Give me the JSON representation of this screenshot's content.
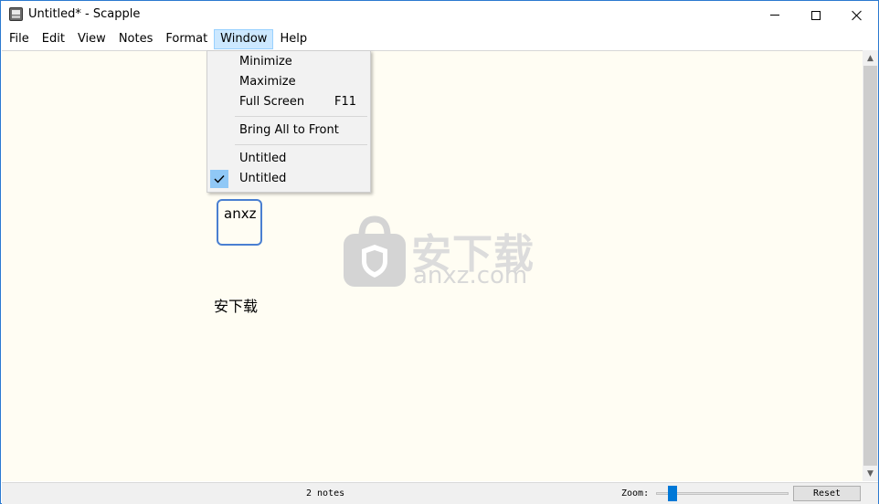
{
  "window": {
    "title": "Untitled* - Scapple",
    "app_icon": "scapple-app-icon"
  },
  "menubar": {
    "items": [
      "File",
      "Edit",
      "View",
      "Notes",
      "Format",
      "Window",
      "Help"
    ],
    "active": "Window"
  },
  "window_menu": {
    "items": [
      {
        "label": "Minimize",
        "shortcut": ""
      },
      {
        "label": "Maximize",
        "shortcut": ""
      },
      {
        "label": "Full Screen",
        "shortcut": "F11"
      },
      {
        "label": "Bring All to Front",
        "shortcut": ""
      },
      {
        "label": "Untitled",
        "shortcut": ""
      },
      {
        "label": "Untitled",
        "shortcut": "",
        "checked": true
      }
    ]
  },
  "canvas": {
    "notes": [
      {
        "text": "anxz",
        "style": "bordered"
      },
      {
        "text": "安下载",
        "style": "plain"
      }
    ],
    "watermark": {
      "cn": "安下载",
      "en": "anxz.com"
    },
    "background": "#fffdf3"
  },
  "statusbar": {
    "note_count": "2 notes",
    "zoom_label": "Zoom:",
    "reset_label": "Reset"
  },
  "colors": {
    "accent": "#0078d7",
    "note_border": "#4a7fd1",
    "menu_highlight": "#cce8ff"
  }
}
